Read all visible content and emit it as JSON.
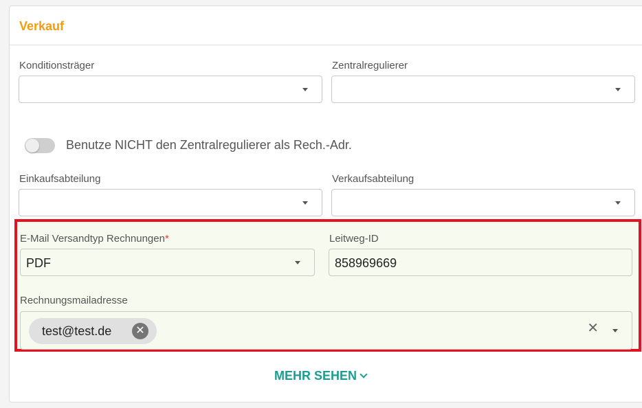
{
  "section": {
    "title": "Verkauf"
  },
  "fields": {
    "konditionstraeger": {
      "label": "Konditionsträger",
      "value": ""
    },
    "zentralregulierer": {
      "label": "Zentralregulierer",
      "value": ""
    },
    "toggle": {
      "label": "Benutze NICHT den Zentralregulierer als Rech.-Adr.",
      "checked": false
    },
    "einkaufsabteilung": {
      "label": "Einkaufsabteilung",
      "value": ""
    },
    "verkaufsabteilung": {
      "label": "Verkaufsabteilung",
      "value": ""
    },
    "email_versandtyp": {
      "label": "E-Mail Versandtyp Rechnungen",
      "required_mark": "*",
      "value": "PDF"
    },
    "leitweg_id": {
      "label": "Leitweg-ID",
      "value": "858969669"
    },
    "rechnungsmail": {
      "label": "Rechnungsmailadresse",
      "chips": [
        "test@test.de"
      ]
    }
  },
  "footer": {
    "more_label": "MEHR SEHEN"
  },
  "colors": {
    "title_accent": "#f39c12",
    "highlight_border": "#e3141f",
    "highlight_bg": "#f7fbef",
    "link": "#1a9e8f",
    "required": "#e53935"
  },
  "icons": {
    "select_caret": "caret-down-icon",
    "chip_remove": "close-circle-icon",
    "clear": "close-icon",
    "more": "chevron-down-icon"
  }
}
